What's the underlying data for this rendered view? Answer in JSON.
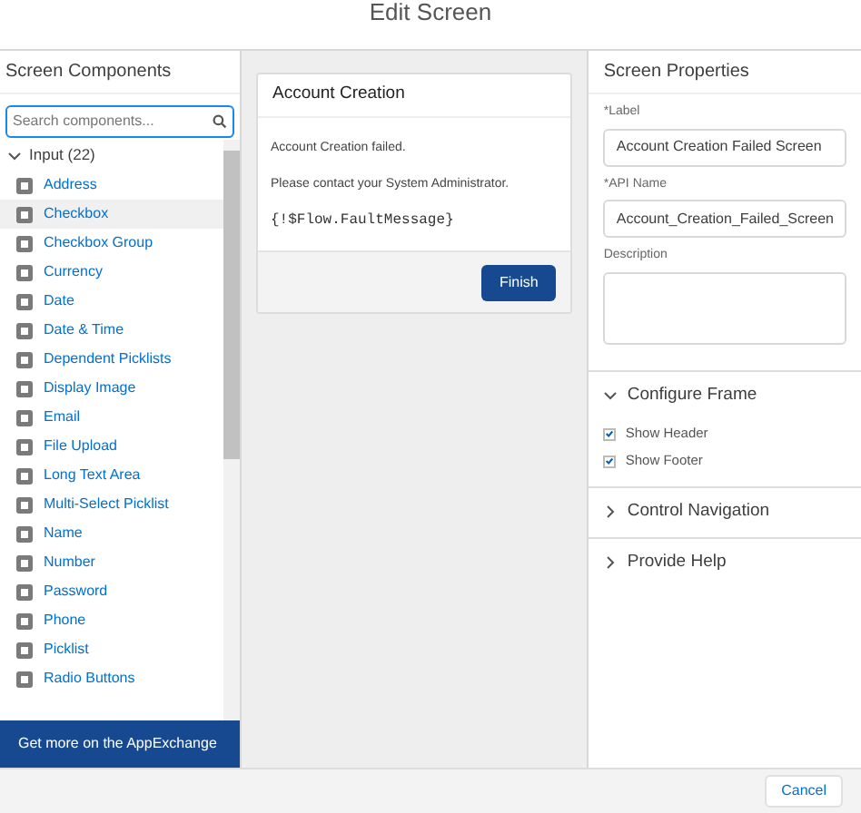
{
  "window": {
    "title": "Edit Screen"
  },
  "components_panel": {
    "title": "Screen Components",
    "search": {
      "placeholder": "Search components..."
    },
    "group": {
      "label": "Input (22)",
      "expanded": true
    },
    "items": [
      {
        "label": "Address",
        "selected": false
      },
      {
        "label": "Checkbox",
        "selected": true
      },
      {
        "label": "Checkbox Group",
        "selected": false
      },
      {
        "label": "Currency",
        "selected": false
      },
      {
        "label": "Date",
        "selected": false
      },
      {
        "label": "Date & Time",
        "selected": false
      },
      {
        "label": "Dependent Picklists",
        "selected": false
      },
      {
        "label": "Display Image",
        "selected": false
      },
      {
        "label": "Email",
        "selected": false
      },
      {
        "label": "File Upload",
        "selected": false
      },
      {
        "label": "Long Text Area",
        "selected": false
      },
      {
        "label": "Multi-Select Picklist",
        "selected": false
      },
      {
        "label": "Name",
        "selected": false
      },
      {
        "label": "Number",
        "selected": false
      },
      {
        "label": "Password",
        "selected": false
      },
      {
        "label": "Phone",
        "selected": false
      },
      {
        "label": "Picklist",
        "selected": false
      },
      {
        "label": "Radio Buttons",
        "selected": false
      }
    ],
    "appexchange_link": "Get more on the AppExchange"
  },
  "screen_card": {
    "title": "Account Creation",
    "lines": [
      "Account Creation failed.",
      "Please contact your System Administrator."
    ],
    "code": "{!$Flow.FaultMessage}",
    "button": "Finish"
  },
  "properties": {
    "title": "Screen Properties",
    "fields": [
      {
        "marker": "*",
        "label": "Label",
        "value": "Account Creation Failed Screen"
      },
      {
        "marker": "*",
        "label": "API Name",
        "value": "Account_Creation_Failed_Screen"
      }
    ],
    "description": {
      "label": "Description"
    },
    "sections": [
      {
        "title": "Configure Frame",
        "expanded": true,
        "options": [
          {
            "label": "Show Header",
            "checked": true
          },
          {
            "label": "Show Footer",
            "checked": true
          }
        ]
      },
      {
        "title": "Control Navigation",
        "expanded": false
      },
      {
        "title": "Provide Help",
        "expanded": false
      }
    ]
  },
  "footer": {
    "button": "Cancel"
  }
}
